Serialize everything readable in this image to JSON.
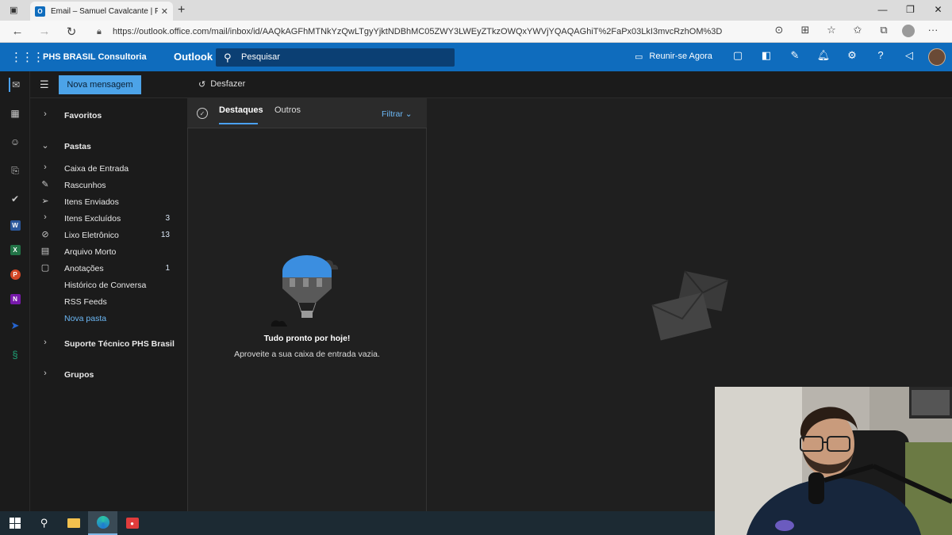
{
  "browser": {
    "tab_title": "Email – Samuel Cavalcante | PHS",
    "tab_close": "✕",
    "new_tab": "+",
    "favicon_letter": "O",
    "url": "https://outlook.office.com/mail/inbox/id/AAQkAGFhMTNkYzQwLTgyYjktNDBhMC05ZWY3LWEyZTkzOWQxYWVjYQAQAGhiT%2FaPx03LkI3mvcRzhOM%3D",
    "window_controls": {
      "minimize": "—",
      "restore": "❐",
      "close": "✕"
    }
  },
  "outlook": {
    "org_name": "PHS BRASIL Consultoria",
    "app_name": "Outlook",
    "search_placeholder": "Pesquisar",
    "meet_now": "Reunir-se Agora",
    "accent": "#0f6cbd",
    "new_message": "Nova mensagem",
    "undo": "Desfazer"
  },
  "folders": {
    "favorites": "Favoritos",
    "folders_header": "Pastas",
    "items": [
      {
        "label": "Caixa de Entrada",
        "count": "",
        "icon": "chevron-right-icon"
      },
      {
        "label": "Rascunhos",
        "count": "",
        "icon": "pencil-icon"
      },
      {
        "label": "Itens Enviados",
        "count": "",
        "icon": "send-icon"
      },
      {
        "label": "Itens Excluídos",
        "count": "3",
        "icon": "chevron-right-icon"
      },
      {
        "label": "Lixo Eletrônico",
        "count": "13",
        "icon": "block-icon"
      },
      {
        "label": "Arquivo Morto",
        "count": "",
        "icon": "archive-icon"
      },
      {
        "label": "Anotações",
        "count": "1",
        "icon": "note-icon"
      },
      {
        "label": "Histórico de Conversa",
        "count": "",
        "icon": ""
      },
      {
        "label": "RSS Feeds",
        "count": "",
        "icon": ""
      }
    ],
    "new_folder": "Nova pasta",
    "support_group": "Suporte Técnico PHS Brasil",
    "groups": "Grupos"
  },
  "message_list": {
    "tab_focused": "Destaques",
    "tab_other": "Outros",
    "filter": "Filtrar",
    "empty_title": "Tudo pronto por hoje!",
    "empty_subtitle": "Aproveite a sua caixa de entrada vazia."
  }
}
